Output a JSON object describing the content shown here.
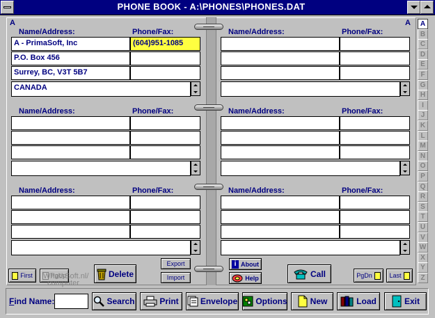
{
  "window": {
    "title": "PHONE BOOK - A:\\PHONES\\PHONES.DAT"
  },
  "left_page": {
    "letter": "A"
  },
  "right_page": {
    "letter": "A"
  },
  "columns": {
    "name": "Name/Address:",
    "phone": "Phone/Fax:"
  },
  "entries": {
    "l0": {
      "lines": [
        "A - PrimaSoft, Inc",
        "P.O. Box 456",
        "Surrey,  BC,  V3T 5B7",
        "CANADA"
      ],
      "phones": [
        "(604)951-1085",
        ""
      ]
    },
    "l1": {
      "lines": [
        "",
        "",
        "",
        ""
      ],
      "phones": [
        "",
        ""
      ]
    },
    "l2": {
      "lines": [
        "",
        "",
        "",
        ""
      ],
      "phones": [
        "",
        ""
      ]
    },
    "r0": {
      "lines": [
        "",
        "",
        "",
        ""
      ],
      "phones": [
        "",
        ""
      ]
    },
    "r1": {
      "lines": [
        "",
        "",
        "",
        ""
      ],
      "phones": [
        "",
        ""
      ]
    },
    "r2": {
      "lines": [
        "",
        "",
        "",
        ""
      ],
      "phones": [
        "",
        ""
      ]
    }
  },
  "alphabet": [
    "A",
    "B",
    "C",
    "D",
    "E",
    "F",
    "G",
    "H",
    "I",
    "J",
    "K",
    "L",
    "M",
    "N",
    "O",
    "P",
    "Q",
    "R",
    "S",
    "T",
    "U",
    "V",
    "W",
    "X",
    "Y",
    "Z"
  ],
  "selected_letter": "A",
  "buttons": {
    "first": "First",
    "pgup": "PgUp",
    "delete": "Delete",
    "export": "Export",
    "import": "Import",
    "about": "About",
    "help": "Help",
    "call": "Call",
    "pgdn": "PgDn",
    "last": "Last",
    "find_label": "Find Name:",
    "search": "Search",
    "print": "Print",
    "envelope": "Envelope",
    "options": "Options",
    "new": "New",
    "load": "Load",
    "exit": "Exit"
  },
  "find": {
    "value": ""
  },
  "watermark": {
    "line1": "WhatsSoft.nl/",
    "line2": "computer"
  },
  "colors": {
    "title_bar": "#000080",
    "text": "#000080",
    "highlight": "#ffff40",
    "face": "#c0c0c0"
  }
}
